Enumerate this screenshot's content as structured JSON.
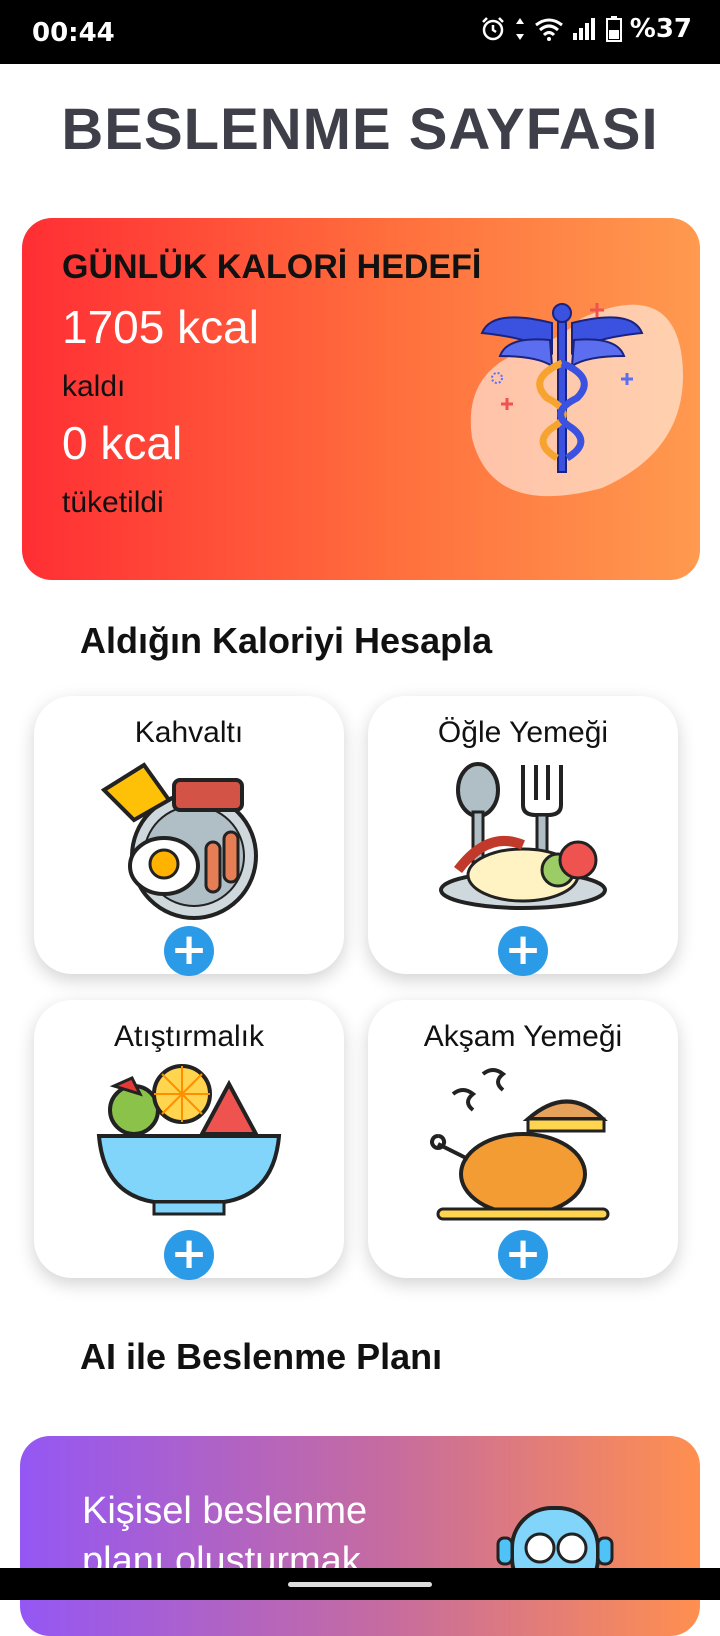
{
  "status": {
    "time": "00:44",
    "battery": "%37"
  },
  "page": {
    "title": "BESLENME SAYFASI"
  },
  "calorie_card": {
    "goal_title": "GÜNLÜK KALORİ HEDEFİ",
    "remaining_value": "1705 kcal",
    "remaining_label": "kaldı",
    "consumed_value": "0 kcal",
    "consumed_label": "tüketildi"
  },
  "calc_section": {
    "title": "Aldığın Kaloriyi Hesapla"
  },
  "meals": [
    {
      "label": "Kahvaltı",
      "add": "+"
    },
    {
      "label": "Öğle Yemeği",
      "add": "+"
    },
    {
      "label": "Atıştırmalık",
      "add": "+"
    },
    {
      "label": "Akşam Yemeği",
      "add": "+"
    }
  ],
  "ai_section": {
    "title": "AI ile Beslenme Planı",
    "card_text": "Kişisel beslenme planı oluşturmak"
  },
  "colors": {
    "accent_red": "#ff2e34",
    "accent_orange": "#ff9a4f",
    "add_blue": "#2b9be8",
    "ai_purple": "#9457f4"
  }
}
